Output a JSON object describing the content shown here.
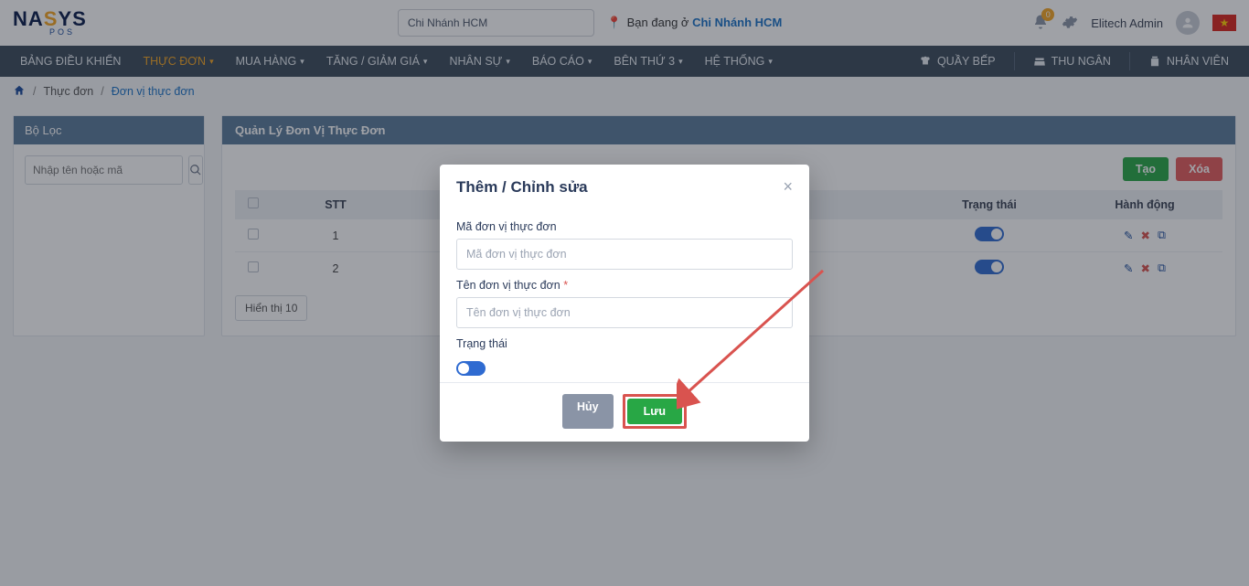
{
  "header": {
    "logo_text": "NASYS",
    "logo_sub": "POS",
    "branch_select": "Chi Nhánh HCM",
    "location_label": "Bạn đang ở ",
    "location_value": "Chi Nhánh HCM",
    "bell_count": "0",
    "user_name": "Elitech Admin"
  },
  "nav": {
    "items": [
      {
        "label": "BẢNG ĐIỀU KHIỂN",
        "caret": false
      },
      {
        "label": "THỰC ĐƠN",
        "caret": true,
        "active": true
      },
      {
        "label": "MUA HÀNG",
        "caret": true
      },
      {
        "label": "TĂNG / GIẢM GIÁ",
        "caret": true
      },
      {
        "label": "NHÂN SỰ",
        "caret": true
      },
      {
        "label": "BÁO CÁO",
        "caret": true
      },
      {
        "label": "BÊN THỨ 3",
        "caret": true
      },
      {
        "label": "HỆ THỐNG",
        "caret": true
      }
    ],
    "right": [
      {
        "label": "QUẦY BẾP"
      },
      {
        "label": "THU NGÂN"
      },
      {
        "label": "NHÂN VIÊN"
      }
    ]
  },
  "breadcrumb": {
    "l1": "Thực đơn",
    "l2": "Đơn vị thực đơn"
  },
  "filter": {
    "title": "Bộ Lọc",
    "placeholder": "Nhập tên hoặc mã"
  },
  "main": {
    "title": "Quản Lý Đơn Vị Thực Đơn",
    "btn_create": "Tạo",
    "btn_delete": "Xóa",
    "cols": {
      "stt": "STT",
      "status": "Trạng thái",
      "action": "Hành động"
    },
    "rows": [
      {
        "stt": "1"
      },
      {
        "stt": "2"
      }
    ],
    "show": "Hiển thị 10"
  },
  "modal": {
    "title": "Thêm / Chỉnh sửa",
    "code_label": "Mã đơn vị thực đơn",
    "code_ph": "Mã đơn vị thực đơn",
    "name_label": "Tên đơn vị thực đơn",
    "name_ph": "Tên đơn vị thực đơn",
    "status_label": "Trạng thái",
    "btn_cancel": "Hủy",
    "btn_save": "Lưu"
  }
}
